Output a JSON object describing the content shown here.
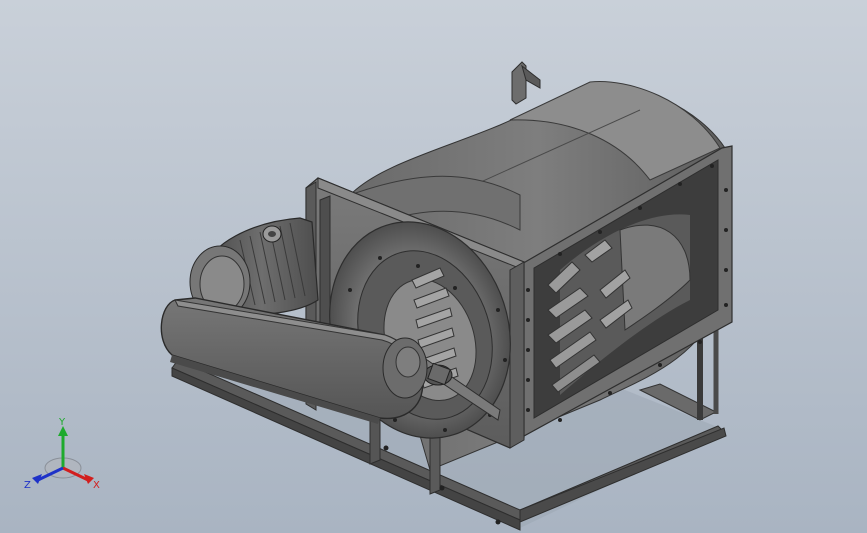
{
  "viewport": {
    "background_top": "#c9d0d9",
    "background_bottom": "#a9b4c2",
    "model_body_color": "#666666",
    "model_dark_color": "#3c3c3c",
    "model_light_color": "#8a8a8a"
  },
  "triad": {
    "x_label": "X",
    "y_label": "Y",
    "z_label": "Z",
    "x_color": "#d21e1e",
    "y_color": "#1eaa2d",
    "z_color": "#1e32c8"
  }
}
